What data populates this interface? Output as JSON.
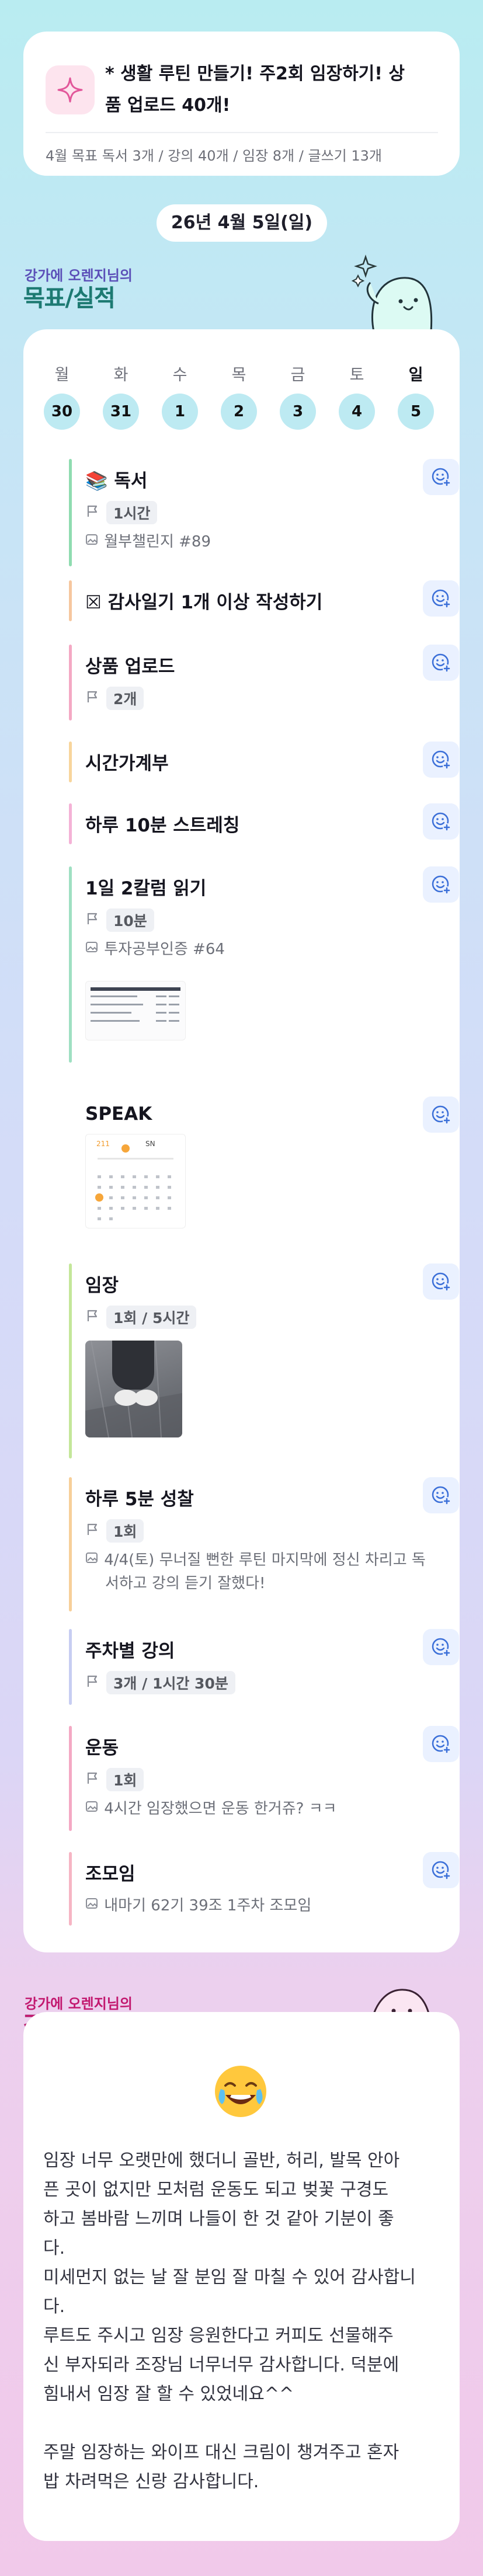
{
  "monthly_goal": {
    "title": "* 생활 루틴 만들기! 주2회 임장하기! 상품 업로드 40개!",
    "title_line1": "* 생활 루틴 만들기! 주2회 임장하기! 상",
    "title_line2": "품 업로드 40개!",
    "summary": "4월 목표  독서 3개 / 강의 40개 / 임장 8개 / 글쓰기 13개"
  },
  "date_label": "26년 4월 5일(일)",
  "goals_section": {
    "owner_label": "강가에 오렌지님의",
    "heading": "목표/실적"
  },
  "week": {
    "days": [
      "월",
      "화",
      "수",
      "목",
      "금",
      "토",
      "일"
    ],
    "dates": [
      "30",
      "31",
      "1",
      "2",
      "3",
      "4",
      "5"
    ]
  },
  "goals": [
    {
      "title": "📚 독서",
      "value": "1시간",
      "note": "월부챌린지 #89",
      "color": "#8fdcb0"
    },
    {
      "title": "☒ 감사일기 1개 이상 작성하기",
      "color": "#f6c79f"
    },
    {
      "title": "상품 업로드",
      "value": "2개",
      "color": "#f4a9c4"
    },
    {
      "title": "시간가계부",
      "color": "#f8d59c"
    },
    {
      "title": "하루 10분 스트레칭",
      "color": "#f4b2d6"
    },
    {
      "title": "1일 2칼럼 읽기",
      "value": "10분",
      "note": "투자공부인증 #64",
      "color": "#9fe0c2"
    },
    {
      "title": "SPEAK",
      "color": "#ffffff"
    },
    {
      "title": "임장",
      "value": "1회",
      "value2": "5시간",
      "color": "#c4e79a"
    },
    {
      "title": "하루 5분 성찰",
      "value": "1회",
      "note": "4/4(토) 무너질 뻔한 루틴 마지막에 정신 차리고 독",
      "note2": "서하고 강의 듣기 잘했다!",
      "color": "#f7cf99"
    },
    {
      "title": "주차별 강의",
      "value": "3개",
      "value2": "1시간 30분",
      "color": "#c7cdf2"
    },
    {
      "title": "운동",
      "value": "1회",
      "note": "4시간 임장했으면 운동 한거쥬? ㅋㅋ",
      "color": "#f4a9c4"
    },
    {
      "title": "조모임",
      "note": "내마기 62기 39조 1주차 조모임",
      "color": "#f6b5c4"
    }
  ],
  "speak_thumb": {
    "count": "211",
    "tag": "SN"
  },
  "gratitude_section": {
    "owner_label": "강가에 오렌지님의",
    "heading": "감사일기"
  },
  "gratitude": {
    "emoji": "joy-face",
    "text": "임장 너무 오랫만에 했더니 골반, 허리, 발목 안아\n픈 곳이 없지만 모처럼 운동도 되고 벚꽃 구경도\n하고 봄바람 느끼며 나들이 한 것 같아 기분이 좋\n다.\n미세먼지 없는 날 잘 분임 잘 마칠 수 있어 감사합니\n다.\n루트도 주시고 임장 응원한다고 커피도 선물해주\n신 부자되라 조장님 너무너무 감사합니다. 덕분에\n힘내서 임장 잘 할 수 있었네요^^\n\n주말 임장하는 와이프 대신 크림이 챙겨주고 혼자\n밥 차려먹은 신랑 감사합니다."
  },
  "colors": {
    "teal_heading": "#1d7a72",
    "pink_heading": "#c2186f",
    "date_circle": "#bdeaf2",
    "reaction_bg": "#eaf1ff",
    "reaction_stroke": "#3b6fd8"
  }
}
